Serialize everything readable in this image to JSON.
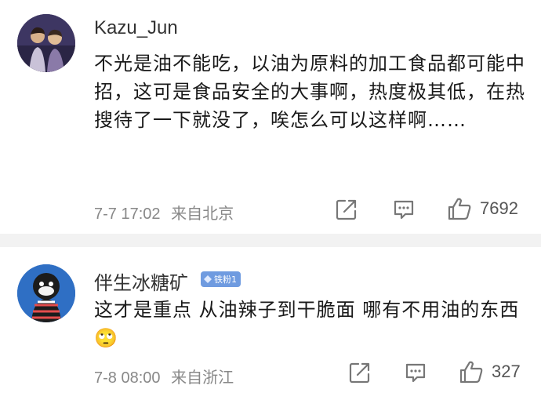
{
  "comments": [
    {
      "username": "Kazu_Jun",
      "text": "不光是油不能吃，以油为原料的加工食品都可能中招，这可是食品安全的大事啊，热度极其低，在热搜待了一下就没了，唉怎么可以这样啊……",
      "time": "7-7 17:02",
      "location": "来自北京",
      "likes": "7692"
    },
    {
      "username": "伴生冰糖矿",
      "badge": "铁粉1",
      "text": "这才是重点 从油辣子到干脆面 哪有不用油的东西🙄",
      "time": "7-8 08:00",
      "location": "来自浙江",
      "likes": "327"
    }
  ],
  "icons": {
    "share": "share-icon",
    "comment": "comment-icon",
    "like": "like-icon"
  },
  "colors": {
    "divider": "#f2f2f2",
    "meta_text": "#888888",
    "badge_bg": "#6f9be0"
  }
}
